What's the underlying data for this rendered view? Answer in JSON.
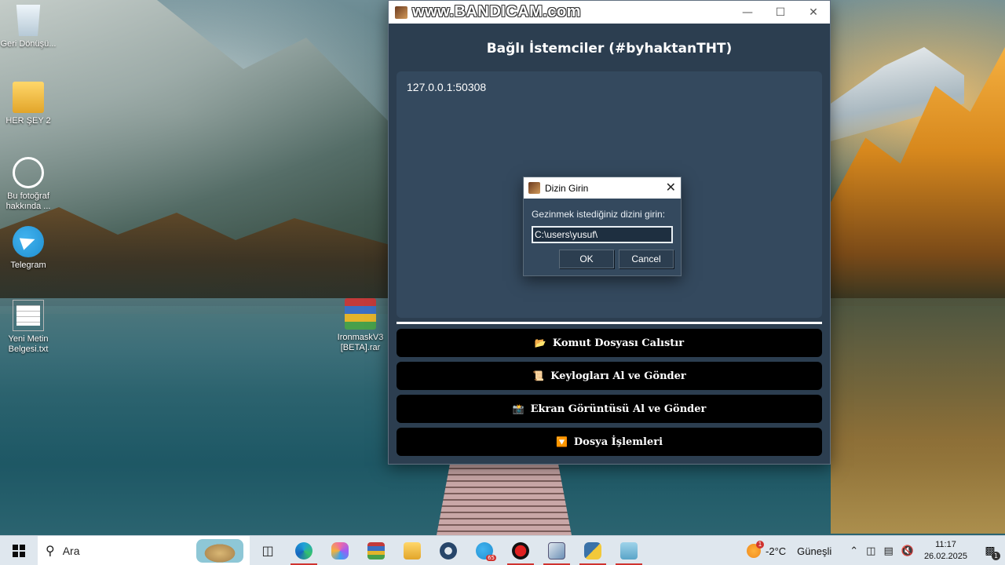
{
  "desktop": {
    "icons": [
      {
        "label": "Geri Dönüşü...",
        "icon": "recycle-bin-icon"
      },
      {
        "label": "HER ŞEY 2",
        "icon": "folder-icon"
      },
      {
        "label": "Bu fotoğraf hakkında ...",
        "icon": "info-icon"
      },
      {
        "label": "Telegram",
        "icon": "telegram-icon"
      },
      {
        "label": "Yeni Metin Belgesi.txt",
        "icon": "text-file-icon"
      },
      {
        "label": "IronmaskV3 [BETA].rar",
        "icon": "winrar-archive-icon"
      }
    ]
  },
  "app": {
    "watermark": "www.BANDICAM.com",
    "header": "Bağlı İstemciler (#byhaktanTHT)",
    "clients": [
      "127.0.0.1:50308"
    ],
    "actions": [
      {
        "icon": "📂",
        "label": "Komut Dosyası Calıstır"
      },
      {
        "icon": "📜",
        "label": "Keylogları Al ve Gönder"
      },
      {
        "icon": "📸",
        "label": "Ekran Görüntüsü Al ve Gönder"
      },
      {
        "icon": "🔽",
        "label": "Dosya İşlemleri"
      }
    ]
  },
  "dialog": {
    "title": "Dizin Girin",
    "prompt": "Gezinmek istediğiniz dizini girin:",
    "input_value": "C:\\users\\yusuf\\",
    "ok_label": "OK",
    "cancel_label": "Cancel"
  },
  "taskbar": {
    "search_placeholder": "Ara",
    "telegram_badge": "65",
    "weather_temp": "-2°C",
    "weather_desc": "Güneşli",
    "weather_badge": "1",
    "time": "11:17",
    "date": "26.02.2025",
    "notification_count": "1"
  },
  "colors": {
    "window_bg": "#2c3e50",
    "list_bg": "#34495e",
    "button_bg": "#000000",
    "taskbar_bg": "#dfe7ee"
  }
}
